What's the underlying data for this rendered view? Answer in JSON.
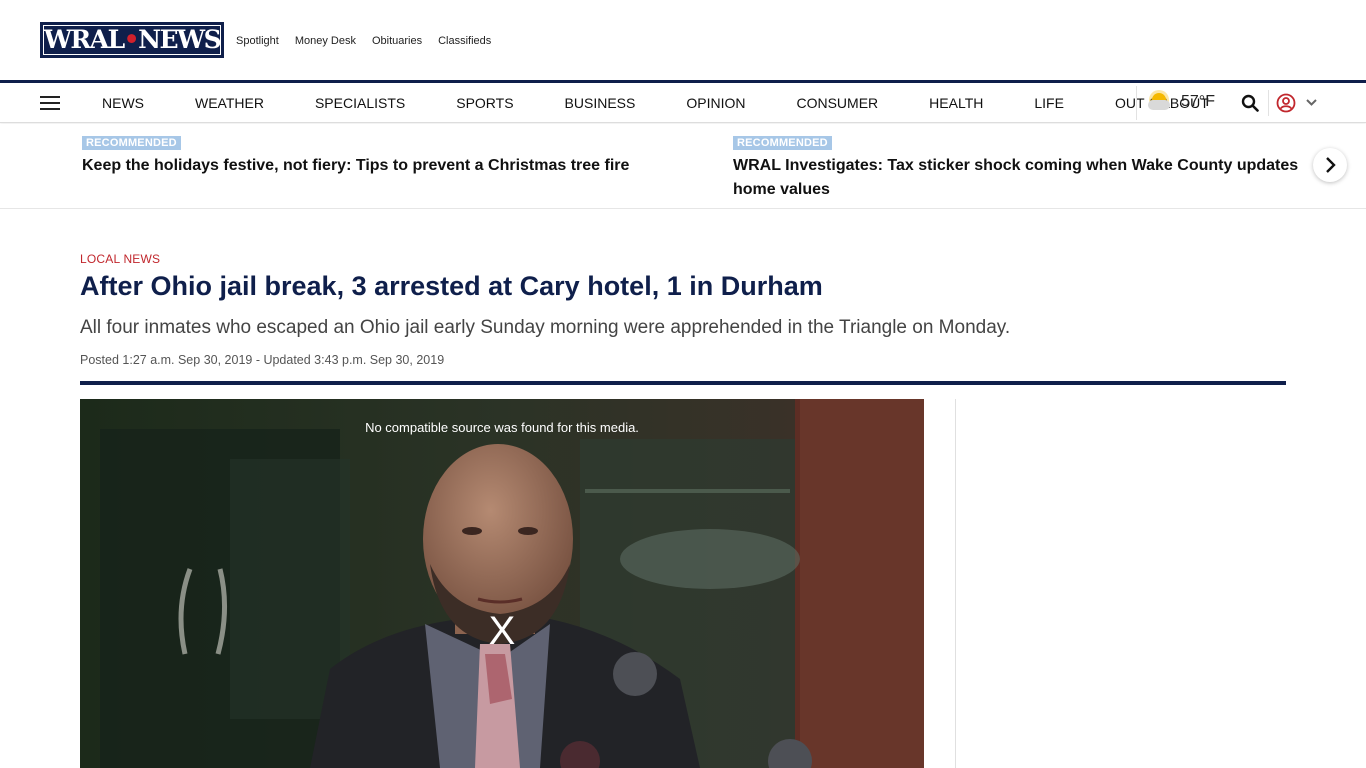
{
  "brand": {
    "logo_text_left": "WRAL",
    "logo_text_right": "NEWS"
  },
  "toplinks": [
    "Spotlight",
    "Money Desk",
    "Obituaries",
    "Classifieds"
  ],
  "nav": {
    "items": [
      "NEWS",
      "WEATHER",
      "SPECIALISTS",
      "SPORTS",
      "BUSINESS",
      "OPINION",
      "CONSUMER",
      "HEALTH",
      "LIFE",
      "OUT & ABOUT"
    ],
    "temperature": "57°F",
    "icons": [
      "menu-icon",
      "partly-cloudy-icon",
      "search-icon",
      "user-icon",
      "chevron-down-icon"
    ]
  },
  "recommended": [
    {
      "badge": "RECOMMENDED",
      "title": "Keep the holidays festive, not fiery: Tips to prevent a Christmas tree fire"
    },
    {
      "badge": "RECOMMENDED",
      "title_line1": "WRAL Investigates: Tax sticker shock coming when Wake County updates",
      "title_line2": "home values"
    }
  ],
  "article": {
    "kicker": "LOCAL NEWS",
    "headline": "After Ohio jail break, 3 arrested at Cary hotel, 1 in Durham",
    "dek": "All four inmates who escaped an Ohio jail early Sunday morning were apprehended in the Triangle on Monday.",
    "dateline": "Posted 1:27 a.m. Sep 30, 2019 - Updated 3:43 p.m. Sep 30, 2019"
  },
  "video": {
    "message": "No compatible source was found for this media.",
    "close_label": "X"
  },
  "colors": {
    "brand_navy": "#0f1f4b",
    "kicker_red": "#c1272d",
    "badge_blue": "#a7c7e7"
  }
}
